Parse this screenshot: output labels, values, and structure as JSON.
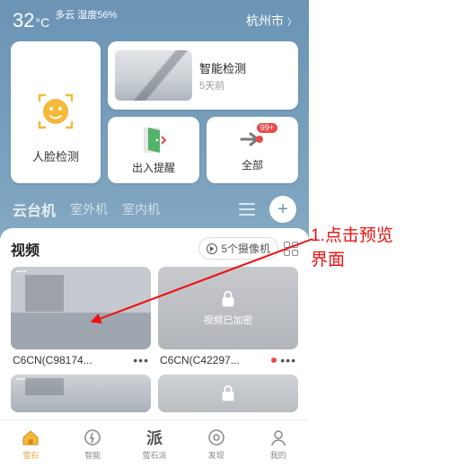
{
  "header": {
    "temp_value": "32",
    "temp_unit": "°C",
    "weather_line1": "多云 湿度56%",
    "city": "杭州市"
  },
  "top_cards": {
    "face_detect": "人脸检测",
    "smart_detect_title": "智能检测",
    "smart_detect_sub": "5天前",
    "entry_alert": "出入提醒",
    "all": "全部",
    "badge": "99+"
  },
  "device_tabs": {
    "active": "云台机",
    "tab2": "室外机",
    "tab3": "室内机"
  },
  "video": {
    "title": "视频",
    "cam_count": "5个摄像机",
    "cameras": [
      {
        "name": "C6CN(C98174...",
        "locked": false
      },
      {
        "name": "C6CN(C42297...",
        "locked": true,
        "locked_label": "视频已加密",
        "alert": true
      }
    ]
  },
  "bottom_nav": {
    "items": [
      {
        "label": "萤石"
      },
      {
        "label": "智能"
      },
      {
        "label": "萤石派"
      },
      {
        "label": "发现"
      },
      {
        "label": "我的"
      }
    ]
  },
  "annotation": {
    "line1": "1.点击预览",
    "line2": "界面"
  }
}
